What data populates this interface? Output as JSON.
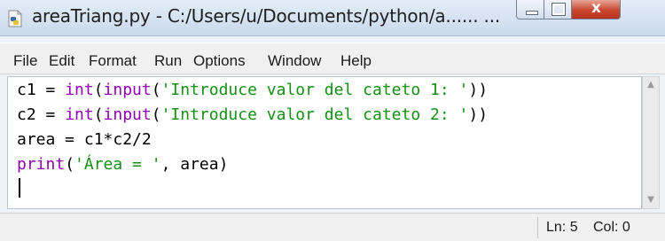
{
  "window": {
    "title": "areaTriang.py - C:/Users/u/Documents/python/a...... ...",
    "icon": "python-file-icon",
    "controls": {
      "minimize": "minimize-icon",
      "maximize": "maximize-icon",
      "close": "x"
    }
  },
  "menu": {
    "items": [
      {
        "label": "File"
      },
      {
        "label": "Edit"
      },
      {
        "label": "Format"
      },
      {
        "label": "Run"
      },
      {
        "label": "Options"
      },
      {
        "label": "Window"
      },
      {
        "label": "Help"
      }
    ]
  },
  "editor": {
    "lines": [
      [
        {
          "t": "c1 = ",
          "k": "plain"
        },
        {
          "t": "int",
          "k": "builtin"
        },
        {
          "t": "(",
          "k": "plain"
        },
        {
          "t": "input",
          "k": "builtin"
        },
        {
          "t": "(",
          "k": "plain"
        },
        {
          "t": "'Introduce valor del cateto 1: '",
          "k": "string"
        },
        {
          "t": "))",
          "k": "plain"
        }
      ],
      [
        {
          "t": "c2 = ",
          "k": "plain"
        },
        {
          "t": "int",
          "k": "builtin"
        },
        {
          "t": "(",
          "k": "plain"
        },
        {
          "t": "input",
          "k": "builtin"
        },
        {
          "t": "(",
          "k": "plain"
        },
        {
          "t": "'Introduce valor del cateto 2: '",
          "k": "string"
        },
        {
          "t": "))",
          "k": "plain"
        }
      ],
      [
        {
          "t": "area = c1*c2/2",
          "k": "plain"
        }
      ],
      [
        {
          "t": "print",
          "k": "builtin"
        },
        {
          "t": "(",
          "k": "plain"
        },
        {
          "t": "'Área = '",
          "k": "string"
        },
        {
          "t": ", area)",
          "k": "plain"
        }
      ]
    ],
    "colors": {
      "builtin": "#8f00b0",
      "string": "#138f13",
      "plain": "#000000"
    }
  },
  "status": {
    "line": "Ln: 5",
    "col": "Col: 0"
  }
}
